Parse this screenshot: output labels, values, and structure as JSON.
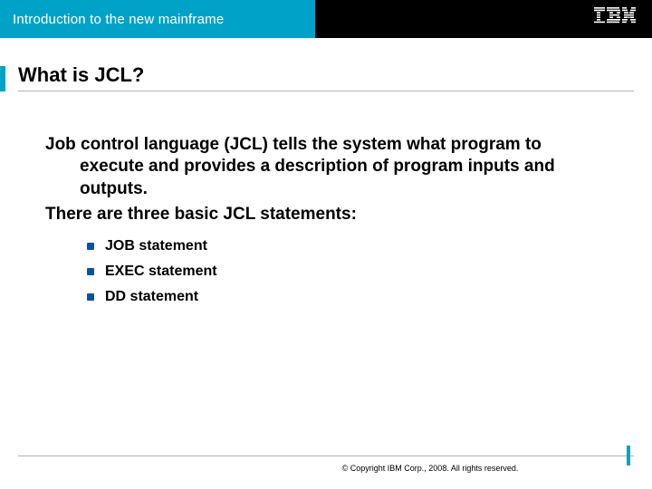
{
  "header": {
    "title": "Introduction to the new mainframe",
    "logo_name": "IBM"
  },
  "slide": {
    "title": "What is JCL?",
    "paragraph1": "Job control language (JCL) tells the system what program to execute and provides a description of program inputs and outputs.",
    "paragraph2": "There are three basic JCL statements:",
    "bullets": [
      "JOB statement",
      "EXEC statement",
      "DD statement"
    ]
  },
  "footer": {
    "copyright": "© Copyright IBM Corp., 2008. All rights reserved."
  }
}
